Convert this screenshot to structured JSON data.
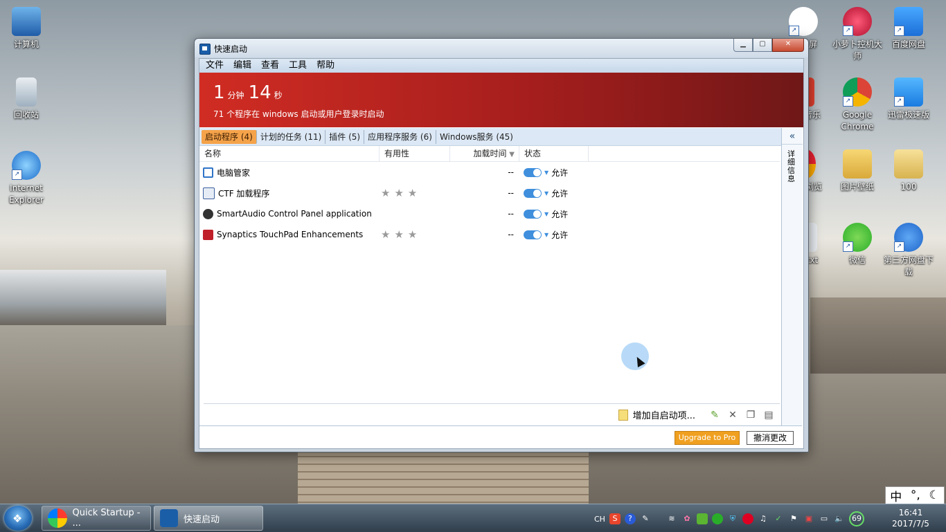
{
  "desktop": {
    "left_icons": [
      {
        "label": "计算机",
        "icon": "computer-icon"
      },
      {
        "label": "回收站",
        "icon": "recycle-bin-icon"
      },
      {
        "label": "Internet Explorer",
        "icon": "ie-icon"
      }
    ],
    "right_icons": [
      {
        "label": "屏",
        "icon": "ev-recorder-icon"
      },
      {
        "label": "小萝卜控机大师",
        "icon": "radish-icon"
      },
      {
        "label": "百度网盘",
        "icon": "baidu-cloud-icon"
      },
      {
        "label": "音乐",
        "icon": "music-icon"
      },
      {
        "label": "Google Chrome",
        "icon": "chrome-icon"
      },
      {
        "label": "迅雷极速版",
        "icon": "thunder-icon"
      },
      {
        "label": "浏览",
        "icon": "browser-icon"
      },
      {
        "label": "图片壁纸",
        "icon": "folder-icon"
      },
      {
        "label": "100",
        "icon": "folder-icon"
      },
      {
        "label": "txt",
        "icon": "text-file-icon"
      },
      {
        "label": "微信",
        "icon": "wechat-icon"
      },
      {
        "label": "第三方网盘下载",
        "icon": "download-icon"
      }
    ]
  },
  "window": {
    "title": "快速启动",
    "controls": {
      "minimize": "▁",
      "maximize": "▢",
      "close": "✕"
    },
    "menu": [
      "文件",
      "编辑",
      "查看",
      "工具",
      "帮助"
    ],
    "banner": {
      "minutes": "1",
      "minutes_unit": "分钟",
      "seconds": "14",
      "seconds_unit": "秒",
      "subtitle": "71 个程序在 windows 启动或用户登录时启动"
    },
    "tabs": [
      {
        "label": "启动程序 (4)",
        "active": true
      },
      {
        "label": "计划的任务 (11)",
        "active": false
      },
      {
        "label": "插件 (5)",
        "active": false
      },
      {
        "label": "应用程序服务 (6)",
        "active": false
      },
      {
        "label": "Windows服务 (45)",
        "active": false
      }
    ],
    "columns": {
      "name": "名称",
      "usefulness": "有用性",
      "load_time": "加载时间",
      "status": "状态"
    },
    "rows": [
      {
        "name": "电脑管家",
        "rating": 0,
        "load_time": "--",
        "status": "允许",
        "icon_color": "#2f74c7"
      },
      {
        "name": "CTF 加载程序",
        "rating": 3,
        "load_time": "--",
        "status": "允许",
        "icon_color": "#3a5f9e"
      },
      {
        "name": "SmartAudio Control Panel application",
        "rating": 0,
        "load_time": "--",
        "status": "允许",
        "icon_color": "#333333"
      },
      {
        "name": "Synaptics TouchPad Enhancements",
        "rating": 3,
        "load_time": "--",
        "status": "允许",
        "icon_color": "#c0202a"
      }
    ],
    "side_panel": {
      "collapse": "«",
      "label": "详细信息"
    },
    "bottom": {
      "add_label": "增加自启动项..."
    },
    "footer": {
      "upgrade": "Upgrade to Pro",
      "cancel": "撤消更改"
    }
  },
  "taskbar": {
    "buttons": [
      {
        "label": "Quick Startup - ..."
      },
      {
        "label": "快速启动"
      }
    ],
    "tray": {
      "lang": "CH",
      "battery": "69"
    },
    "time": "16:41",
    "date": "2017/7/5",
    "ime": {
      "mode": "中",
      "punct": "°,",
      "moon": "☾"
    }
  },
  "colors": {
    "banner": "#c0262a",
    "accent_tab": "#f5a34a",
    "upgrade": "#f0a020",
    "toggle": "#3f8fdd"
  }
}
